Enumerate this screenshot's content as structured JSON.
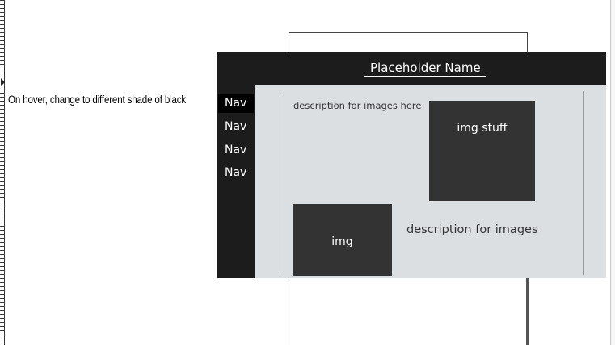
{
  "annotation": {
    "text": "On hover, change to different shade of black"
  },
  "header": {
    "title": "Placeholder Name"
  },
  "nav": {
    "items": [
      {
        "label": "Nav",
        "active": true
      },
      {
        "label": "Nav",
        "active": false
      },
      {
        "label": "Nav",
        "active": false
      },
      {
        "label": "Nav",
        "active": false
      }
    ]
  },
  "content": {
    "desc_top": "description for images here",
    "img_top_label": "img stuff",
    "img_bottom_label": "img",
    "desc_bottom": "description for images"
  },
  "colors": {
    "header_bg": "#1c1c1c",
    "nav_active_bg": "#000000",
    "content_bg": "#dcdfe2",
    "image_placeholder_bg": "#333333"
  }
}
